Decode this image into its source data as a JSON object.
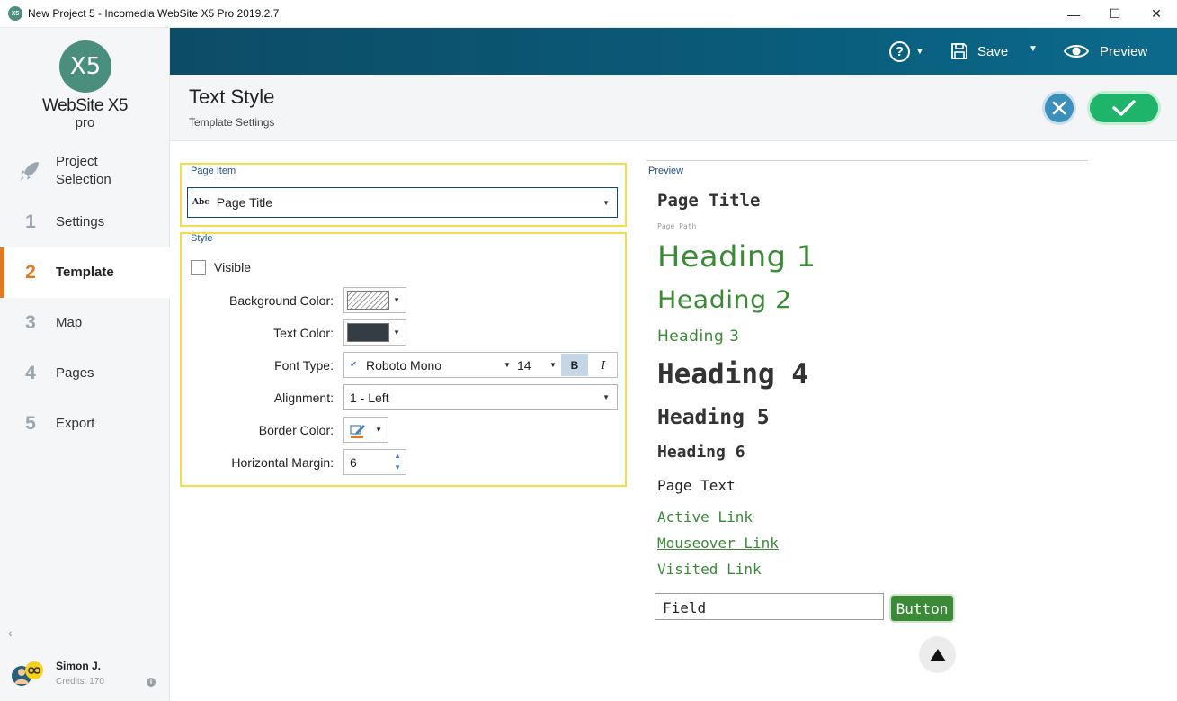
{
  "window": {
    "title": "New Project 5 - Incomedia WebSite X5 Pro 2019.2.7",
    "app_icon": "X5",
    "controls": {
      "minimize": "—",
      "maximize": "☐",
      "close": "✕"
    }
  },
  "logo": {
    "mark": "X5",
    "name": "WebSite X5",
    "edition": "pro"
  },
  "sidebar": {
    "items": [
      {
        "num": "",
        "label_line1": "Project",
        "label_line2": "Selection",
        "icon": "rocket-icon"
      },
      {
        "num": "1",
        "label": "Settings"
      },
      {
        "num": "2",
        "label": "Template",
        "active": true
      },
      {
        "num": "3",
        "label": "Map"
      },
      {
        "num": "4",
        "label": "Pages"
      },
      {
        "num": "5",
        "label": "Export"
      }
    ],
    "collapse_glyph": "‹",
    "user": {
      "name": "Simon J.",
      "credits": "Credits: 170",
      "info": "i"
    }
  },
  "topbar": {
    "help": "?",
    "save_label": "Save",
    "preview_label": "Preview"
  },
  "header": {
    "title": "Text Style",
    "subtitle": "Template Settings"
  },
  "form": {
    "page_item_group": "Page Item",
    "page_item_icon_text": "Abc",
    "page_item_value": "Page Title",
    "style_group": "Style",
    "visible_label": "Visible",
    "visible_checked": false,
    "background_color_label": "Background Color:",
    "text_color_label": "Text Color:",
    "text_color_value": "#353d44",
    "font_type_label": "Font Type:",
    "font_name": "Roboto Mono",
    "font_size": "14",
    "bold": "B",
    "italic": "I",
    "alignment_label": "Alignment:",
    "alignment_value": "1 - Left",
    "border_color_label": "Border Color:",
    "horizontal_margin_label": "Horizontal Margin:",
    "horizontal_margin_value": "6"
  },
  "preview": {
    "label": "Preview",
    "page_title": "Page Title",
    "page_path": "Page Path",
    "heading1": "Heading 1",
    "heading2": "Heading 2",
    "heading3": "Heading 3",
    "heading4": "Heading 4",
    "heading5": "Heading 5",
    "heading6": "Heading 6",
    "page_text": "Page Text",
    "active_link": "Active Link",
    "mouseover_link": "Mouseover Link",
    "visited_link": "Visited Link",
    "field": "Field",
    "button": "Button"
  },
  "colors": {
    "accent_orange": "#e07a1f",
    "topbar": "#0d4c66",
    "preview_green": "#3a8a36",
    "ok_green": "#1eb56a",
    "cancel_blue": "#3c8fb8",
    "group_border": "#f2de4a"
  }
}
